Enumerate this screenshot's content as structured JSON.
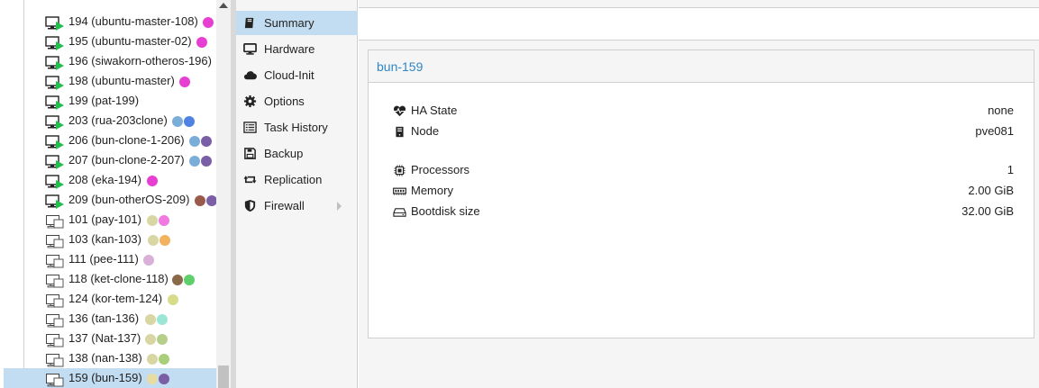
{
  "tree": {
    "items": [
      {
        "label": "194 (ubuntu-master-108)",
        "status": "running",
        "tags": [
          "#e83fd3"
        ]
      },
      {
        "label": "195 (ubuntu-master-02)",
        "status": "running",
        "tags": [
          "#e83fd3"
        ]
      },
      {
        "label": "196 (siwakorn-otheros-196)",
        "status": "running",
        "tags": []
      },
      {
        "label": "198 (ubuntu-master)",
        "status": "running",
        "tags": [
          "#e83fd3"
        ]
      },
      {
        "label": "199 (pat-199)",
        "status": "running",
        "tags": []
      },
      {
        "label": "203 (rua-203clone)",
        "status": "running",
        "tags": [
          "#7aaed8",
          "#4f82e3"
        ]
      },
      {
        "label": "206 (bun-clone-1-206)",
        "status": "running",
        "tags": [
          "#7aaed8",
          "#7a5fa6"
        ]
      },
      {
        "label": "207 (bun-clone-2-207)",
        "status": "running",
        "tags": [
          "#7aaed8",
          "#7a5fa6"
        ]
      },
      {
        "label": "208 (eka-194)",
        "status": "running",
        "tags": [
          "#e83fd3"
        ]
      },
      {
        "label": "209 (bun-otherOS-209)",
        "status": "running",
        "tags": [
          "#9a5a4b",
          "#7a5fa6"
        ]
      },
      {
        "label": "101 (pay-101)",
        "status": "template",
        "tags": [
          "#d8d6a3",
          "#f07adf"
        ]
      },
      {
        "label": "103 (kan-103)",
        "status": "template",
        "tags": [
          "#d8d6a3",
          "#f2b25e"
        ]
      },
      {
        "label": "111 (pee-111)",
        "status": "template",
        "tags": [
          "#dbb0d8"
        ]
      },
      {
        "label": "118 (ket-clone-118)",
        "status": "template",
        "tags": [
          "#8a6a4a",
          "#5fcf6e"
        ]
      },
      {
        "label": "124 (kor-tem-124)",
        "status": "template",
        "tags": [
          "#d6dc8a"
        ]
      },
      {
        "label": "136 (tan-136)",
        "status": "template",
        "tags": [
          "#d8d6a3",
          "#9be6d5"
        ]
      },
      {
        "label": "137 (Nat-137)",
        "status": "template",
        "tags": [
          "#d8d6a3",
          "#b5cf8a"
        ]
      },
      {
        "label": "138 (nan-138)",
        "status": "template",
        "tags": [
          "#d8d6a3",
          "#a9cf7a"
        ]
      },
      {
        "label": "159 (bun-159)",
        "status": "template",
        "tags": [
          "#e7dca3",
          "#7a5fa6"
        ],
        "selected": true
      }
    ]
  },
  "nav": {
    "items": [
      {
        "label": "Summary",
        "icon": "book-icon",
        "active": true
      },
      {
        "label": "Hardware",
        "icon": "desktop-icon"
      },
      {
        "label": "Cloud-Init",
        "icon": "cloud-icon"
      },
      {
        "label": "Options",
        "icon": "gear-icon"
      },
      {
        "label": "Task History",
        "icon": "list-icon"
      },
      {
        "label": "Backup",
        "icon": "floppy-icon"
      },
      {
        "label": "Replication",
        "icon": "retweet-icon"
      },
      {
        "label": "Firewall",
        "icon": "shield-icon",
        "submenu": true
      }
    ]
  },
  "summary": {
    "title": "bun-159",
    "rows": [
      {
        "label": "HA State",
        "value": "none",
        "icon": "heartbeat-icon"
      },
      {
        "label": "Node",
        "value": "pve081",
        "icon": "server-icon"
      },
      {
        "label": "Processors",
        "value": "1",
        "icon": "cpu-icon"
      },
      {
        "label": "Memory",
        "value": "2.00 GiB",
        "icon": "memory-icon"
      },
      {
        "label": "Bootdisk size",
        "value": "32.00 GiB",
        "icon": "hdd-icon"
      }
    ]
  },
  "colors": {
    "selection": "#c2ddf2",
    "title_blue": "#2e87c8",
    "running_green": "#21bf4b"
  }
}
